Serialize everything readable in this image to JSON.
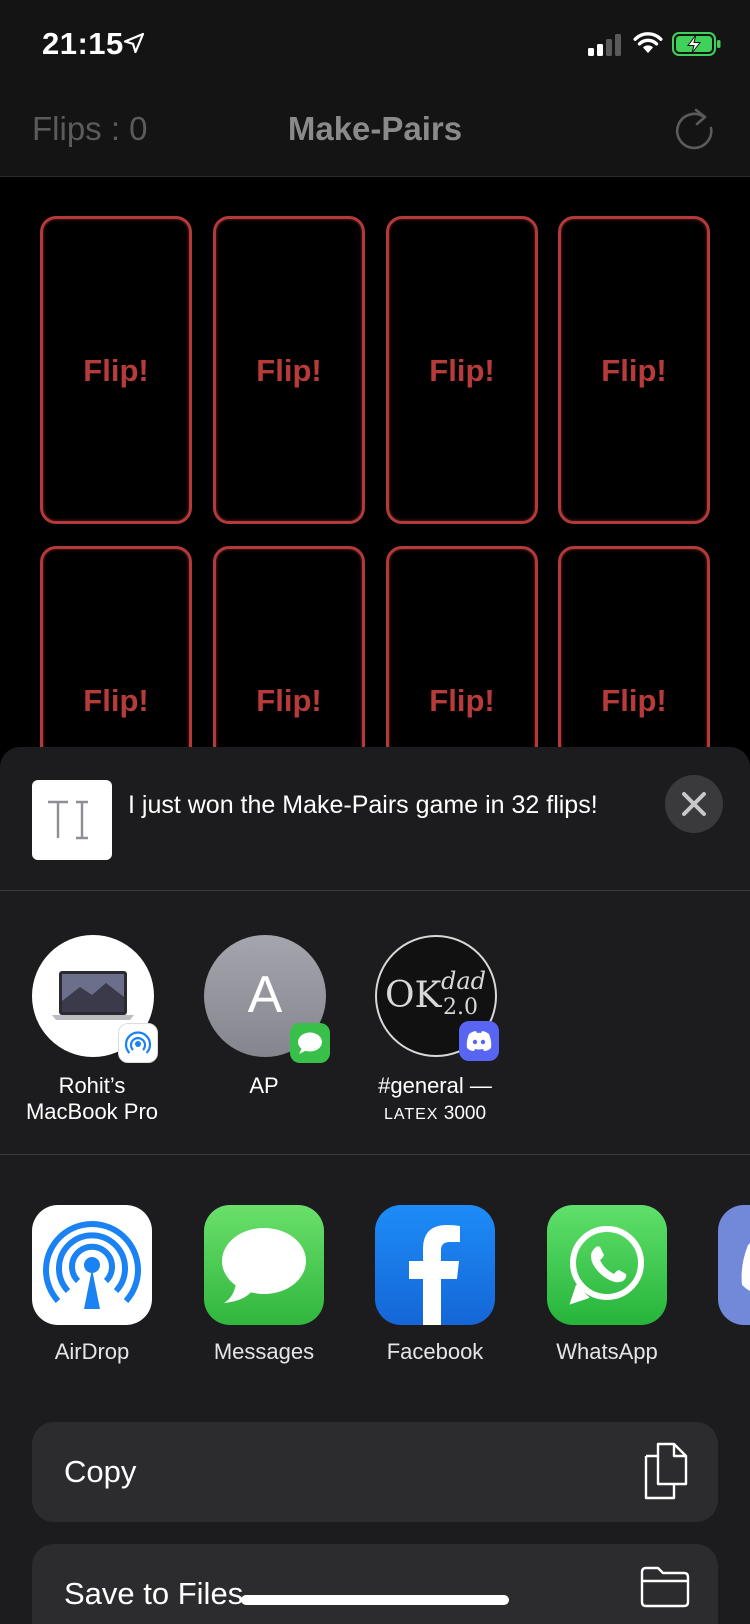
{
  "status_bar": {
    "time": "21:15"
  },
  "nav": {
    "flips": "Flips : 0",
    "title": "Make-Pairs"
  },
  "cards": [
    "Flip!",
    "Flip!",
    "Flip!",
    "Flip!",
    "Flip!",
    "Flip!",
    "Flip!",
    "Flip!"
  ],
  "share": {
    "message": "I just won the Make-Pairs game in 32 flips!",
    "people": [
      {
        "name_line1": "Rohit’s",
        "name_line2": "MacBook Pro"
      },
      {
        "initial": "A",
        "name_line1": "AP",
        "name_line2": ""
      },
      {
        "avatar_text_main": "OK",
        "avatar_text_sup": "dad",
        "avatar_text_sub": "2.0",
        "name_line1": "#general —",
        "name_line2_caps": "LATEX",
        "name_line2_rest": " 3000"
      }
    ],
    "apps": [
      "AirDrop",
      "Messages",
      "Facebook",
      "WhatsApp",
      "D"
    ],
    "actions": [
      "Copy",
      "Save to Files"
    ]
  },
  "colors": {
    "card_border": "#b33a3a",
    "sheet_bg": "#1c1c1e",
    "action_bg": "#2c2c2e"
  }
}
